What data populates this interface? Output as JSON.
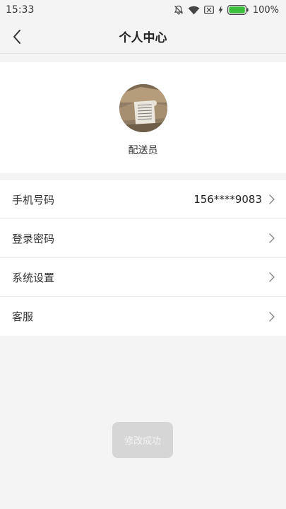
{
  "status_bar": {
    "time": "15:33",
    "battery_percent": "100%",
    "icons": [
      "mute-bell-icon",
      "wifi-icon",
      "sim-off-icon",
      "charging-icon",
      "battery-icon"
    ],
    "battery_color": "#3cbf3c"
  },
  "header": {
    "title": "个人中心",
    "back_icon": "back-arrow-icon"
  },
  "profile": {
    "role": "配送员"
  },
  "menu": {
    "items": [
      {
        "label": "手机号码",
        "value": "156****9083"
      },
      {
        "label": "登录密码",
        "value": ""
      },
      {
        "label": "系统设置",
        "value": ""
      },
      {
        "label": "客服",
        "value": ""
      }
    ]
  },
  "toast": {
    "text": "修改成功"
  }
}
